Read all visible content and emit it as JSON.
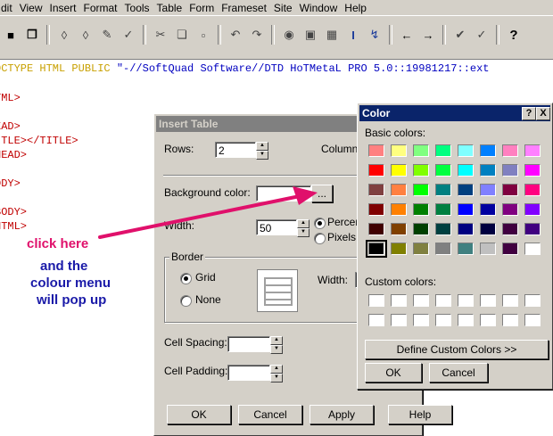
{
  "menubar": {
    "items": [
      "dit",
      "View",
      "Insert",
      "Format",
      "Tools",
      "Table",
      "Form",
      "Frameset",
      "Site",
      "Window",
      "Help"
    ]
  },
  "toolbar": {
    "buttons": [
      "save-icon",
      "save-all-icon",
      "find-icon",
      "find-next-icon",
      "replace-icon",
      "spell-check-icon",
      "cut-icon",
      "copy-icon",
      "paste-icon",
      "undo-icon",
      "redo-icon",
      "image-icon",
      "table-icon",
      "calendar-icon",
      "cursor-icon",
      "link-icon",
      "back-icon",
      "forward-icon",
      "validate-icon",
      "check-icon",
      "help-icon"
    ]
  },
  "code": {
    "doctype_part1": "OCTYPE HTML PUBLIC ",
    "doctype_part2": "\"-//SoftQuad Software//DTD HoTMetaL PRO 5.0::19981217::ext",
    "lines": [
      "TML>",
      "EAD>",
      "ITLE></TITLE>",
      "HEAD>",
      "ODY>",
      "BODY>",
      "HTML>"
    ]
  },
  "annotation": {
    "line1": "click here",
    "line2": "and the",
    "line3": "colour menu",
    "line4": "will pop up"
  },
  "insert_table": {
    "title": "Insert Table",
    "rows_label": "Rows:",
    "rows_value": "2",
    "columns_label": "Columns",
    "bg_color_label": "Background color:",
    "bg_color_button": "...",
    "width_label": "Width:",
    "width_value": "50",
    "percent_label": "Percen",
    "pixels_label": "Pixels",
    "border_group": "Border",
    "grid_label": "Grid",
    "none_label": "None",
    "border_width_label": "Width:",
    "cell_spacing_label": "Cell Spacing:",
    "cell_padding_label": "Cell Padding:",
    "ok_button": "OK",
    "cancel_button": "Cancel",
    "apply_button": "Apply",
    "help_button": "Help"
  },
  "color_dialog": {
    "title": "Color",
    "help_btn": "?",
    "close_btn": "X",
    "basic_colors_label": "Basic colors:",
    "custom_colors_label": "Custom colors:",
    "define_button": "Define Custom Colors >>",
    "ok_button": "OK",
    "cancel_button": "Cancel",
    "basic_colors": [
      [
        "#ff8080",
        "#ffff80",
        "#80ff80",
        "#00ff80",
        "#80ffff",
        "#0080ff",
        "#ff80c0",
        "#ff80ff"
      ],
      [
        "#ff0000",
        "#ffff00",
        "#80ff00",
        "#00ff40",
        "#00ffff",
        "#0080c0",
        "#8080c0",
        "#ff00ff"
      ],
      [
        "#804040",
        "#ff8040",
        "#00ff00",
        "#008080",
        "#004080",
        "#8080ff",
        "#800040",
        "#ff0080"
      ],
      [
        "#800000",
        "#ff8000",
        "#008000",
        "#008040",
        "#0000ff",
        "#0000a0",
        "#800080",
        "#8000ff"
      ],
      [
        "#400000",
        "#804000",
        "#004000",
        "#004040",
        "#000080",
        "#000040",
        "#400040",
        "#400080"
      ],
      [
        "#000000",
        "#808000",
        "#808040",
        "#808080",
        "#408080",
        "#c0c0c0",
        "#400040",
        "#ffffff"
      ]
    ]
  }
}
